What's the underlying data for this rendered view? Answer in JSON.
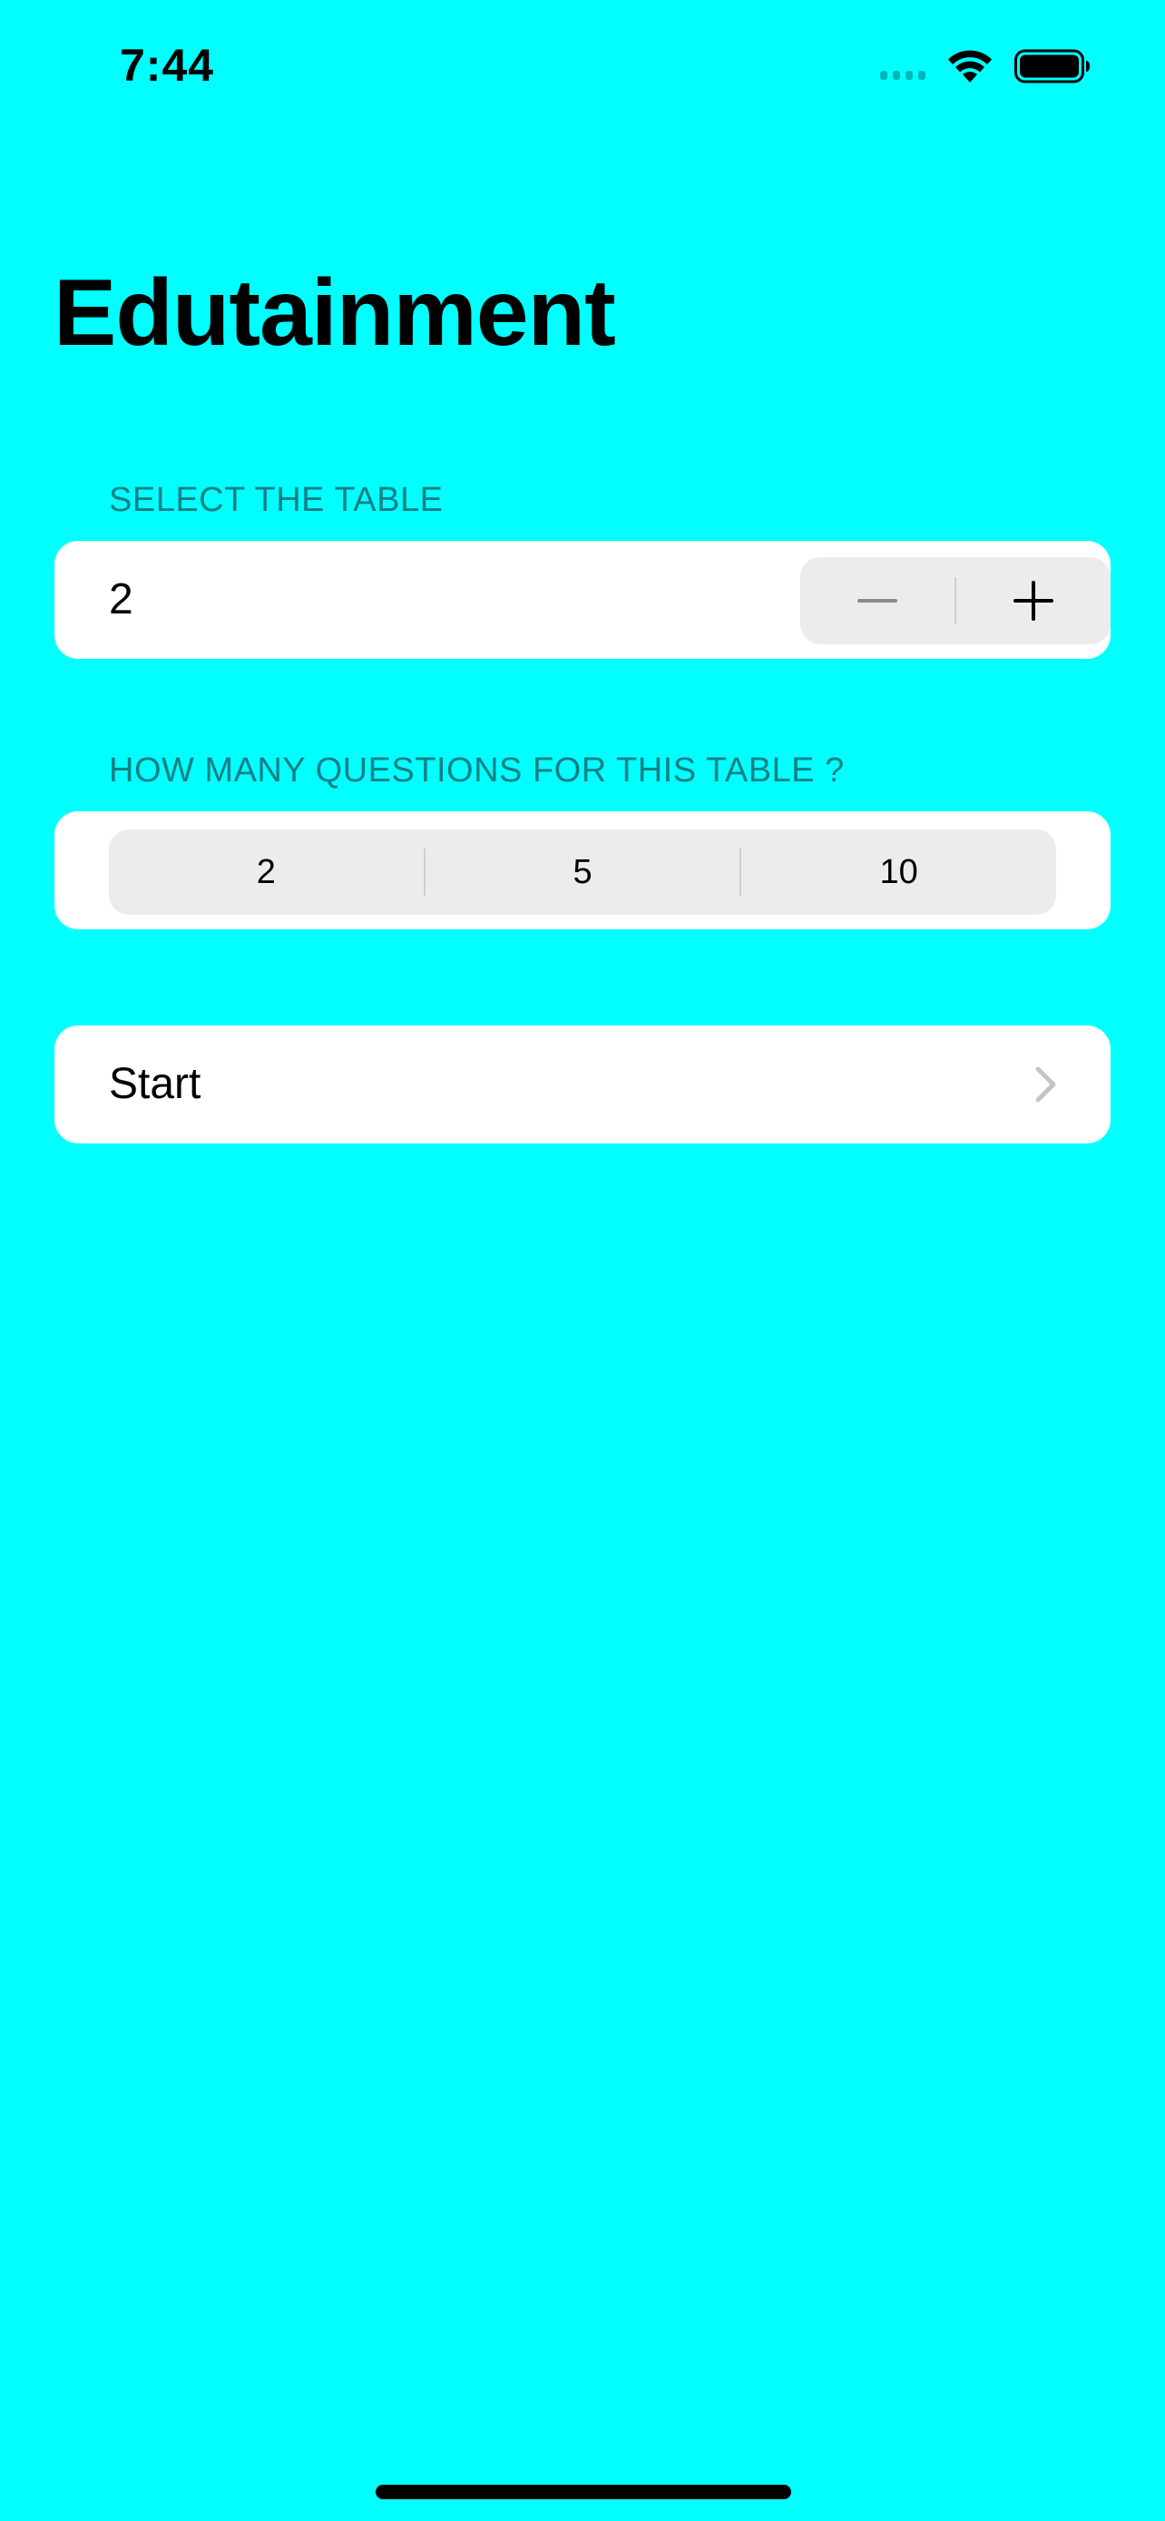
{
  "status_bar": {
    "time": "7:44",
    "icons": [
      "cellular-signal-icon",
      "wifi-icon",
      "battery-icon"
    ]
  },
  "navigation": {
    "title": "Edutainment"
  },
  "table_section": {
    "header": "SELECT THE TABLE",
    "stepper_value": "2",
    "decrement_icon": "minus-icon",
    "increment_icon": "plus-icon"
  },
  "questions_section": {
    "header": "HOW MANY QUESTIONS FOR THIS TABLE ?",
    "options": [
      "2",
      "5",
      "10"
    ],
    "selected": null
  },
  "start_row": {
    "label": "Start",
    "icon": "chevron-right-icon"
  },
  "colors": {
    "background": "#00FFFF",
    "card": "#FFFFFF",
    "section_header": "#147F85",
    "control_fill": "#ECECED"
  }
}
